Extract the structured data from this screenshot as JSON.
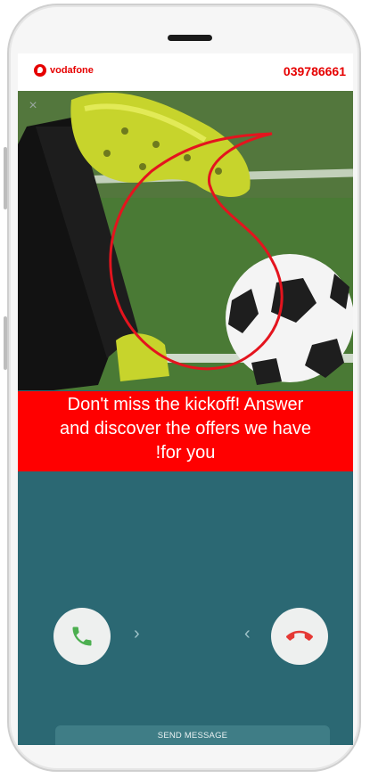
{
  "header": {
    "brand": "vodafone",
    "phone_number": "039786661"
  },
  "hero": {
    "close_icon": "close-icon"
  },
  "banner": {
    "line1": "Don't miss the kickoff! Answer",
    "line2": "and discover the offers we have",
    "line3": "!for you"
  },
  "actions": {
    "accept_icon": "phone-icon",
    "decline_icon": "phone-hangup-icon",
    "arrow_right": "›",
    "arrow_left": "‹",
    "send_message": "SEND MESSAGE"
  },
  "colors": {
    "brand_red": "#e60000",
    "banner_red": "#ff0000",
    "screen_teal": "#2b6873",
    "accept_green": "#4caf50",
    "decline_red": "#e53935"
  }
}
